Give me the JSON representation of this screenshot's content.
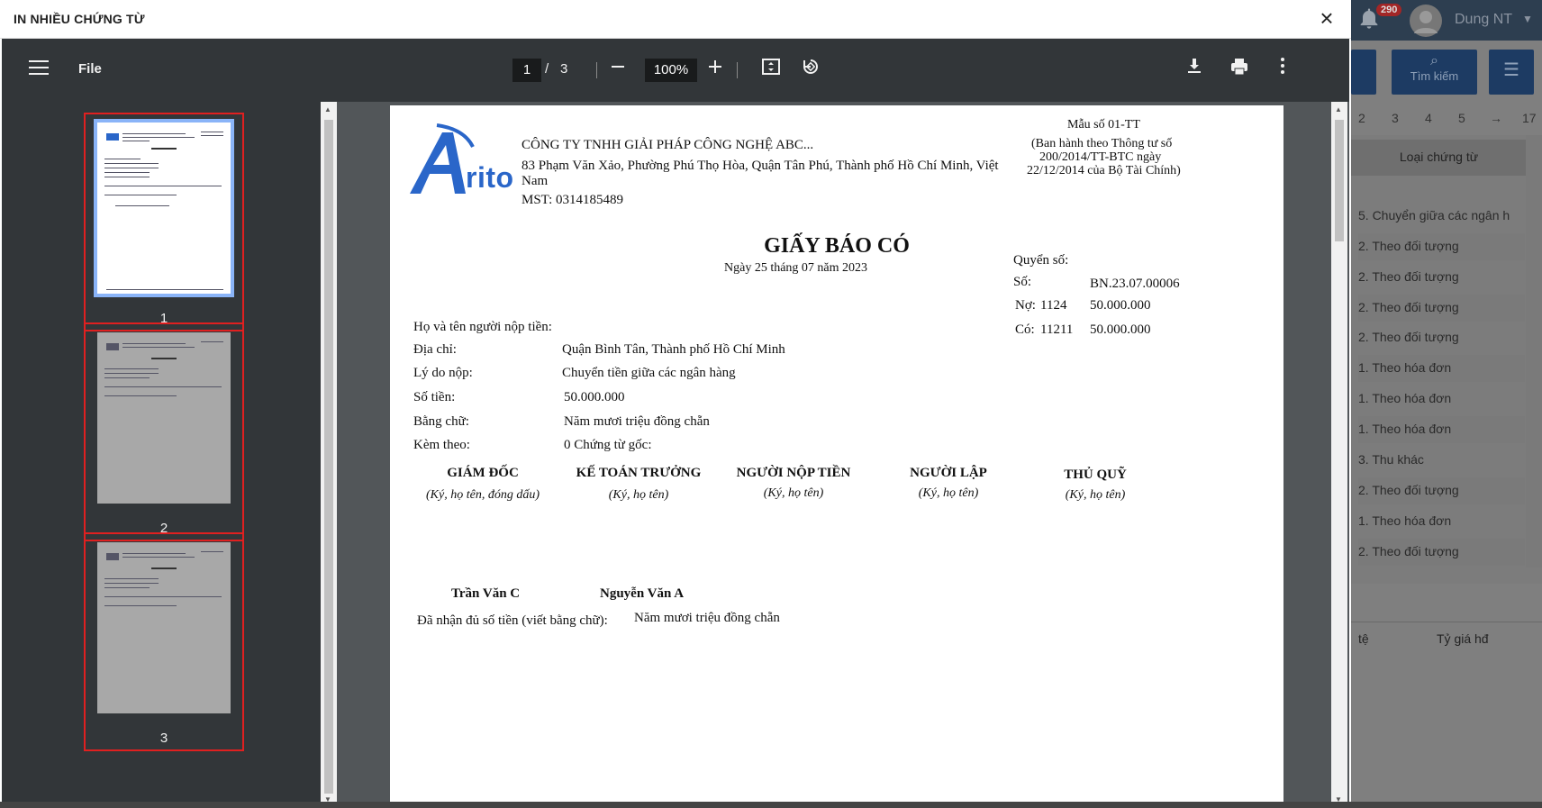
{
  "background": {
    "notification_count": "290",
    "user_name": "Dung NT",
    "search_button_label": "Tìm kiếm",
    "pager": [
      "2",
      "3",
      "4",
      "5",
      "→",
      "17"
    ],
    "grid_header": "Loại chứng từ",
    "grid_rows": [
      "5. Chuyển giữa các ngân h",
      "2. Theo đối tượng",
      "2. Theo đối tượng",
      "2. Theo đối tượng",
      "2. Theo đối tượng",
      "1. Theo hóa đơn",
      "1. Theo hóa đơn",
      "1. Theo hóa đơn",
      "3. Thu khác",
      "2. Theo đối tượng",
      "1. Theo hóa đơn",
      "2. Theo đối tượng"
    ],
    "grid2_headers": [
      "tệ",
      "Tỷ giá hđ"
    ]
  },
  "modal": {
    "title": "IN NHIỀU CHỨNG TỪ"
  },
  "viewer": {
    "file_label": "File",
    "current_page": "1",
    "page_separator": "/",
    "total_pages": "3",
    "zoom": "100%",
    "thumbnails": [
      {
        "label": "1",
        "selected": true
      },
      {
        "label": "2",
        "selected": false
      },
      {
        "label": "3",
        "selected": false
      }
    ]
  },
  "document": {
    "logo_text": "rito",
    "company_name": "CÔNG TY TNHH GIẢI PHÁP CÔNG NGHỆ ABC...",
    "company_address_line1": "83 Phạm Văn Xảo, Phường Phú Thọ Hòa, Quận Tân Phú, Thành phố Hồ Chí Minh, Việt",
    "company_address_line2": "Nam",
    "tax_code": "MST: 0314185489",
    "form_number": "Mẫu số 01-TT",
    "form_note_line1": "(Ban hành theo Thông tư số",
    "form_note_line2": "200/2014/TT-BTC ngày",
    "form_note_line3": "22/12/2014 của Bộ Tài Chính)",
    "title": "GIẤY BÁO CÓ",
    "date": "Ngày 25 tháng 07 năm 2023",
    "book_label": "Quyển số:",
    "number_label": "Số:",
    "number_value": "BN.23.07.00006",
    "debit_label": "Nợ:",
    "debit_account": "1124",
    "debit_amount": "50.000.000",
    "credit_label": "Có:",
    "credit_account": "11211",
    "credit_amount": "50.000.000",
    "payer_label": "Họ và tên người nộp tiền:",
    "address_label": "Địa chỉ:",
    "address_value": "Quận Bình Tân, Thành phố Hồ Chí Minh",
    "reason_label": "Lý do nộp:",
    "reason_value": "Chuyển tiền giữa các ngân hàng",
    "amount_label": "Số tiền:",
    "amount_value": "50.000.000",
    "words_label": "Bằng chữ:",
    "words_value": "Năm mươi triệu đồng chẵn",
    "attached_label": "Kèm theo:",
    "attached_value": "0 Chứng từ gốc:",
    "signatures": [
      {
        "title": "GIÁM ĐỐC",
        "note": "(Ký, họ tên, đóng dấu)",
        "name": "Trần Văn C"
      },
      {
        "title": "KẾ TOÁN TRƯỞNG",
        "note": "(Ký, họ tên)",
        "name": "Nguyễn Văn A"
      },
      {
        "title": "NGƯỜI NỘP TIỀN",
        "note": "(Ký, họ tên)",
        "name": ""
      },
      {
        "title": "NGƯỜI LẬP",
        "note": "(Ký, họ tên)",
        "name": ""
      },
      {
        "title": "THỦ QUỸ",
        "note": "(Ký, họ tên)",
        "name": ""
      }
    ],
    "received_label": "Đã nhận đủ số tiền (viết bằng chữ):",
    "received_value": "Năm mươi triệu đồng chẵn"
  }
}
